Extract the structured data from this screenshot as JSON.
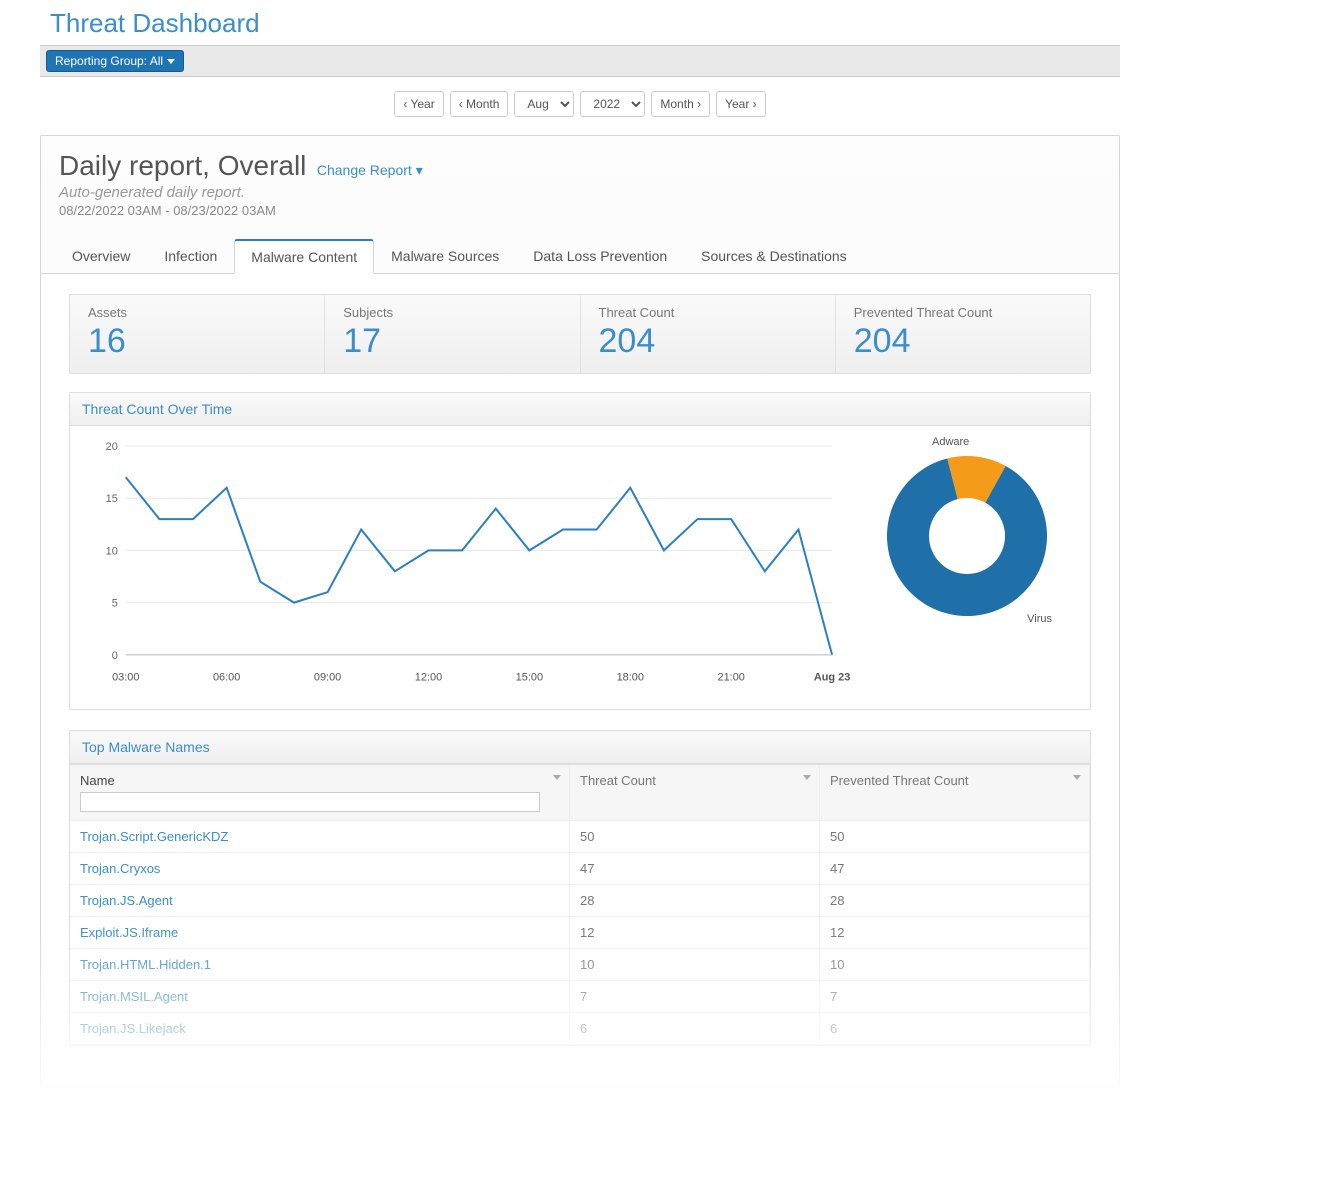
{
  "page": {
    "title": "Threat Dashboard"
  },
  "toolbar": {
    "reporting_group_label": "Reporting Group: All"
  },
  "date_nav": {
    "prev_year": "‹ Year",
    "prev_month": "‹ Month",
    "month_value": "Aug",
    "year_value": "2022",
    "next_month": "Month ›",
    "next_year": "Year ›"
  },
  "report": {
    "title": "Daily report, Overall",
    "change_label": "Change Report ▾",
    "subtitle": "Auto-generated daily report.",
    "date_range": "08/22/2022 03AM - 08/23/2022 03AM"
  },
  "tabs": [
    {
      "label": "Overview"
    },
    {
      "label": "Infection"
    },
    {
      "label": "Malware Content"
    },
    {
      "label": "Malware Sources"
    },
    {
      "label": "Data Loss Prevention"
    },
    {
      "label": "Sources & Destinations"
    }
  ],
  "active_tab_index": 2,
  "kpis": [
    {
      "label": "Assets",
      "value": "16"
    },
    {
      "label": "Subjects",
      "value": "17"
    },
    {
      "label": "Threat Count",
      "value": "204"
    },
    {
      "label": "Prevented Threat Count",
      "value": "204"
    }
  ],
  "chart_panel_title": "Threat Count Over Time",
  "malware_panel_title": "Top Malware Names",
  "malware_columns": {
    "name": "Name",
    "threat": "Threat Count",
    "prevented": "Prevented Threat Count"
  },
  "malware_rows": [
    {
      "name": "Trojan.Script.GenericKDZ",
      "threat": "50",
      "prevented": "50"
    },
    {
      "name": "Trojan.Cryxos",
      "threat": "47",
      "prevented": "47"
    },
    {
      "name": "Trojan.JS.Agent",
      "threat": "28",
      "prevented": "28"
    },
    {
      "name": "Exploit.JS.Iframe",
      "threat": "12",
      "prevented": "12"
    },
    {
      "name": "Trojan.HTML.Hidden.1",
      "threat": "10",
      "prevented": "10"
    },
    {
      "name": "Trojan.MSIL.Agent",
      "threat": "7",
      "prevented": "7"
    },
    {
      "name": "Trojan.JS.Likejack",
      "threat": "6",
      "prevented": "6"
    }
  ],
  "chart_data": [
    {
      "type": "line",
      "title": "Threat Count Over Time",
      "xlabel": "",
      "ylabel": "",
      "ylim": [
        0,
        20
      ],
      "x_ticks": [
        "03:00",
        "06:00",
        "09:00",
        "12:00",
        "15:00",
        "18:00",
        "21:00",
        "Aug 23"
      ],
      "x": [
        "03:00",
        "04:00",
        "05:00",
        "06:00",
        "07:00",
        "08:00",
        "09:00",
        "10:00",
        "11:00",
        "12:00",
        "13:00",
        "14:00",
        "15:00",
        "16:00",
        "17:00",
        "18:00",
        "19:00",
        "20:00",
        "21:00",
        "Aug 23"
      ],
      "values": [
        17,
        13,
        13,
        16,
        7,
        5,
        6,
        12,
        8,
        10,
        10,
        14,
        10,
        12,
        12,
        16,
        10,
        13,
        13,
        8,
        12,
        0
      ]
    },
    {
      "type": "pie",
      "series": [
        {
          "name": "Virus",
          "value": 88
        },
        {
          "name": "Adware",
          "value": 12
        }
      ]
    }
  ]
}
